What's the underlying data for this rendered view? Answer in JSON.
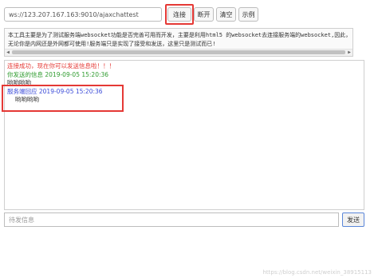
{
  "toolbar": {
    "url_value": "ws://123.207.167.163:9010/ajaxchattest",
    "connect_label": "连接",
    "disconnect_label": "断开",
    "clear_label": "清空",
    "example_label": "示例"
  },
  "notice": {
    "line1": "本工具主要是为了测试服务端websocket功能是否完善可用而开发，主要是利用html5 的websocket去连接服务端的websocket,因此，",
    "line2": "无论你是内网还是外网都可使用!服务端只是实现了接受和发送，这里只是测试而已!",
    "left_arrow": "◀",
    "right_arrow": "▶"
  },
  "log": {
    "connected_msg": "连接成功，现在你可以发送信息啦！！！",
    "sent_header": "你发送的信息 2019-09-05 15:20:36",
    "sent_body": "哟哟哟哟",
    "reply_header": "服务端回应 2019-09-05 15:20:36",
    "reply_body": "哟哟哟哟"
  },
  "composer": {
    "placeholder": "待发信息",
    "send_label": "发送"
  },
  "watermark": "https://blog.csdn.net/weixin_38915113",
  "colors": {
    "highlight": "#e53935",
    "connected": "#e53935",
    "sent": "#2e9b2e",
    "reply": "#3b4bd8"
  }
}
